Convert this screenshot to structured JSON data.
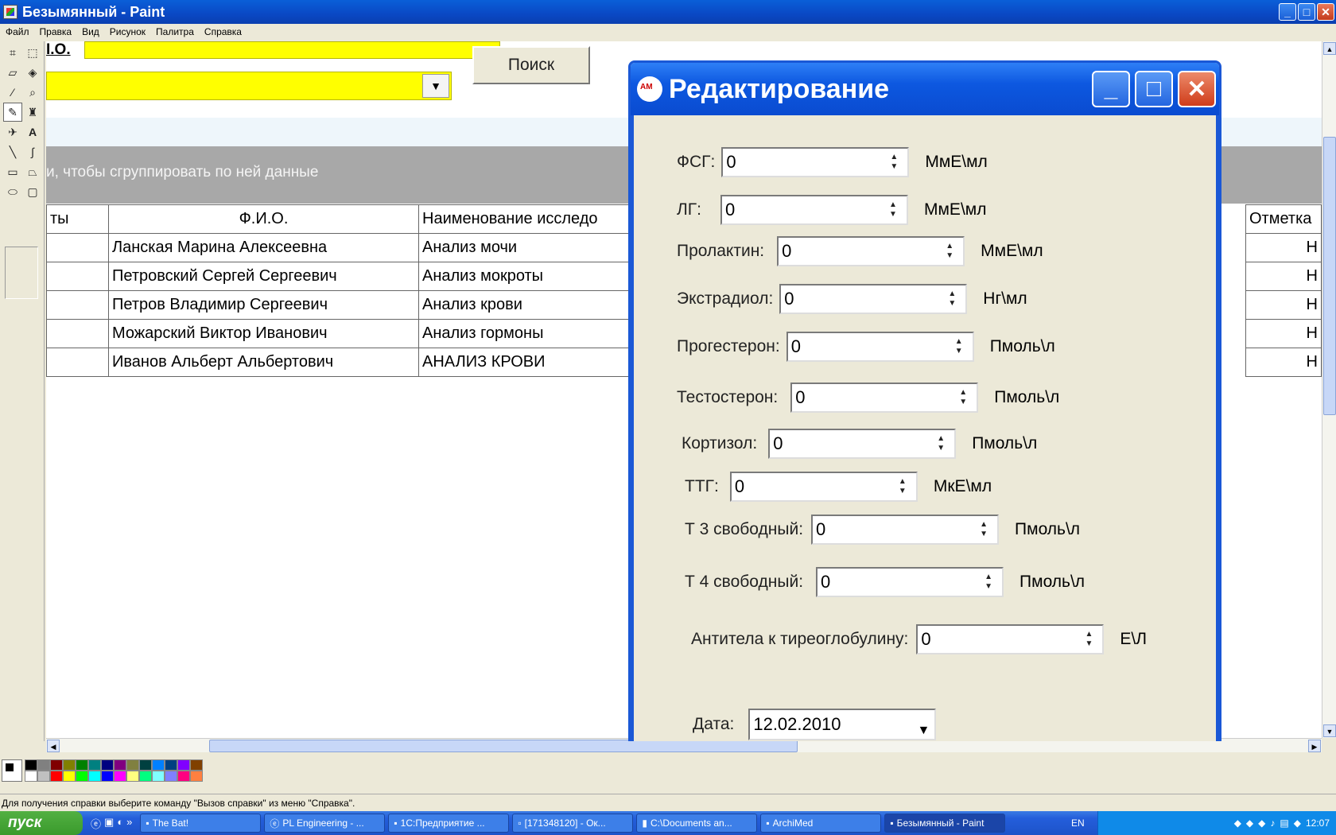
{
  "window": {
    "title": "Безымянный - Paint",
    "min": "_",
    "max": "□",
    "close": "✕"
  },
  "menu": [
    "Файл",
    "Правка",
    "Вид",
    "Рисунок",
    "Палитра",
    "Справка"
  ],
  "canvas": {
    "fio_label": "I.O.",
    "search_button": "Поиск",
    "dropdown_arrow": "▼",
    "group_hint": "и, чтобы сгруппировать по ней данные",
    "columns": [
      "ты",
      "Ф.И.О.",
      "Наименование исследо"
    ],
    "rows": [
      [
        "",
        "Ланская Марина Алексеевна",
        "Анализ мочи"
      ],
      [
        "",
        "Петровский Сергей Сергеевич",
        "Анализ мокроты"
      ],
      [
        "",
        "Петров Владимир Сергеевич",
        "Анализ крови"
      ],
      [
        "",
        "Можарский Виктор Иванович",
        "Анализ гормоны"
      ],
      [
        "",
        "Иванов Альберт Альбертович",
        "АНАЛИЗ КРОВИ"
      ]
    ],
    "right_column": {
      "header": "Отметка",
      "cells": [
        "Н",
        "Н",
        "Н",
        "Н",
        "Н"
      ]
    }
  },
  "dialog": {
    "title": "Редактирование",
    "fields": [
      {
        "label": "ФСГ:",
        "value": "0",
        "unit": "МмЕ\\мл"
      },
      {
        "label": "ЛГ:",
        "value": "0",
        "unit": "МмЕ\\мл"
      },
      {
        "label": "Пролактин:",
        "value": "0",
        "unit": "МмЕ\\мл"
      },
      {
        "label": "Экстрадиол:",
        "value": "0",
        "unit": "Нг\\мл"
      },
      {
        "label": "Прогестерон:",
        "value": "0",
        "unit": "Пмоль\\л"
      },
      {
        "label": "Тестостерон:",
        "value": "0",
        "unit": "Пмоль\\л"
      },
      {
        "label": "Кортизол:",
        "value": "0",
        "unit": "Пмоль\\л"
      },
      {
        "label": "ТТГ:",
        "value": "0",
        "unit": "МкЕ\\мл"
      },
      {
        "label": "Т 3 свободный:",
        "value": "0",
        "unit": "Пмоль\\л"
      },
      {
        "label": "Т 4 свободный:",
        "value": "0",
        "unit": "Пмоль\\л"
      },
      {
        "label": "Антитела к тиреоглобулину:",
        "value": "0",
        "unit": "Е\\Л"
      }
    ],
    "date_label": "Дата:",
    "date_value": "12.02.2010"
  },
  "statusbar": "Для получения справки выберите команду \"Вызов справки\" из меню \"Справка\".",
  "taskbar": {
    "start": "пуск",
    "tasks": [
      "The Bat!",
      "PL Engineering - ...",
      "1С:Предприятие ...",
      "[171348120] - Ок...",
      "C:\\Documents an...",
      "ArchiMed",
      "Безымянный - Paint"
    ],
    "lang": "EN",
    "clock": "12:07"
  },
  "palette_colors": [
    "#000000",
    "#808080",
    "#800000",
    "#808000",
    "#008000",
    "#008080",
    "#000080",
    "#800080",
    "#808040",
    "#004040",
    "#0080ff",
    "#004080",
    "#8000ff",
    "#804000",
    "#ffffff",
    "#c0c0c0",
    "#ff0000",
    "#ffff00",
    "#00ff00",
    "#00ffff",
    "#0000ff",
    "#ff00ff",
    "#ffff80",
    "#00ff80",
    "#80ffff",
    "#8080ff",
    "#ff0080",
    "#ff8040"
  ]
}
